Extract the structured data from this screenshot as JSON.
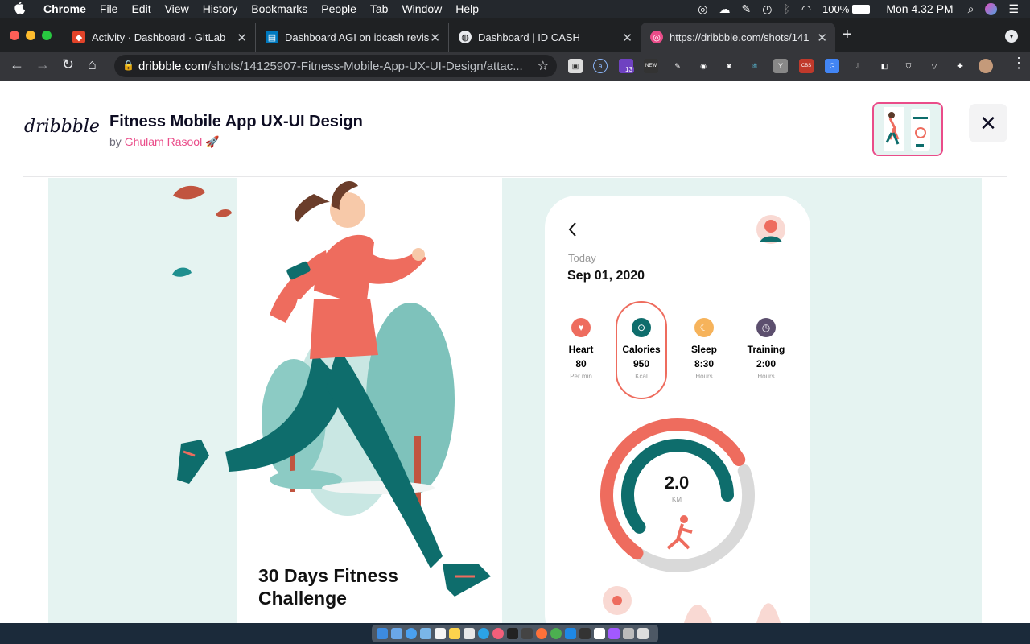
{
  "menubar": {
    "app": "Chrome",
    "items": [
      "File",
      "Edit",
      "View",
      "History",
      "Bookmarks",
      "People",
      "Tab",
      "Window",
      "Help"
    ],
    "battery": "100%",
    "clock": "Mon 4.32 PM"
  },
  "tabs": [
    {
      "title": "Activity · Dashboard · GitLab",
      "icon": "gitlab-icon"
    },
    {
      "title": "Dashboard AGI on idcash revis",
      "icon": "trello-icon"
    },
    {
      "title": "Dashboard | ID CASH",
      "icon": "globe-icon"
    },
    {
      "title": "https://dribbble.com/shots/141",
      "icon": "dribbble-icon"
    }
  ],
  "omnibox": {
    "host": "dribbble.com",
    "path": "/shots/14125907-Fitness-Mobile-App-UX-UI-Design/attac..."
  },
  "extensions": {
    "badge": "13",
    "new_label": "NEW",
    "cbs_label": "CBS"
  },
  "shot": {
    "logo": "dribbble",
    "title": "Fitness Mobile App UX-UI Design",
    "by": "by",
    "author": "Ghulam Rasool",
    "emoji": "🚀"
  },
  "app": {
    "headline_1": "30 Days Fitness",
    "headline_2": "Challenge",
    "today_label": "Today",
    "date": "Sep 01, 2020",
    "stats": [
      {
        "label": "Heart",
        "value": "80",
        "unit": "Per min",
        "color": "#ee6c5e",
        "glyph": "♥"
      },
      {
        "label": "Calories",
        "value": "950",
        "unit": "Kcal",
        "color": "#0e6d6c",
        "glyph": "⊙"
      },
      {
        "label": "Sleep",
        "value": "8:30",
        "unit": "Hours",
        "color": "#f6b35b",
        "glyph": "☾"
      },
      {
        "label": "Training",
        "value": "2:00",
        "unit": "Hours",
        "color": "#5c4f6e",
        "glyph": "◷"
      }
    ],
    "distance": "2.0",
    "distance_unit": "KM"
  },
  "colors": {
    "accent": "#ea4c89",
    "teal": "#0e6d6c",
    "coral": "#ee6c5e"
  }
}
